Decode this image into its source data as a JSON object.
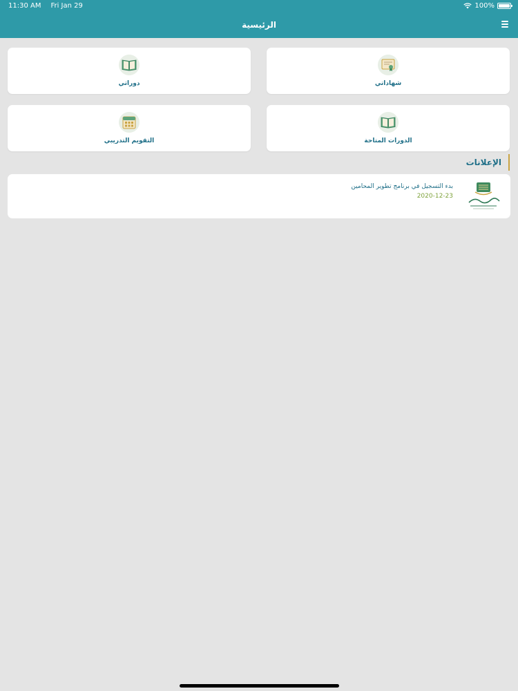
{
  "status_bar": {
    "time": "11:30 AM",
    "date": "Fri Jan 29",
    "battery": "100%",
    "battery_level": 1.0
  },
  "header": {
    "title": "الرئيسية",
    "menu_icon": "hamburger-icon"
  },
  "tiles": [
    {
      "label": "شهاداتي",
      "icon": "certificate-icon"
    },
    {
      "label": "دوراتي",
      "icon": "book-icon"
    },
    {
      "label": "الدورات المتاحة",
      "icon": "book-icon"
    },
    {
      "label": "التقويم التدريبي",
      "icon": "calendar-icon"
    }
  ],
  "announcements": {
    "title": "الإعلانات",
    "items": [
      {
        "text": "بدء التسجيل في برنامج تطوير المحامين",
        "date": "2020-12-23",
        "logo_icon": "training-center-logo"
      }
    ]
  },
  "colors": {
    "accent": "#2e9aa8",
    "label": "#1f6f88",
    "date": "#7ea23b",
    "gold": "#c9a443"
  }
}
